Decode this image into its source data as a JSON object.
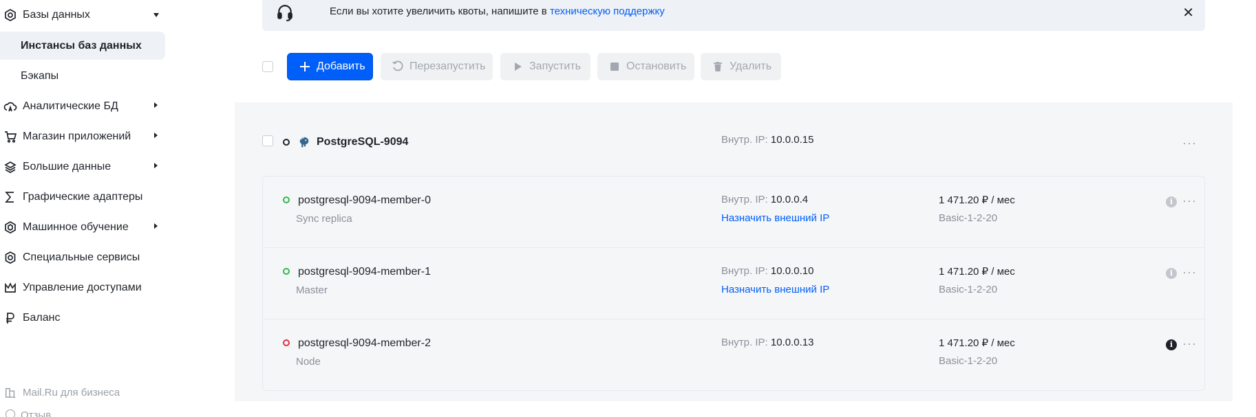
{
  "sidebar": {
    "databases": "Базы данных",
    "db_instances": "Инстансы баз данных",
    "backups": "Бэкапы",
    "analytic_db": "Аналитические БД",
    "app_store": "Магазин приложений",
    "big_data": "Большие данные",
    "gpu": "Графические адаптеры",
    "ml": "Машинное обучение",
    "special": "Специальные сервисы",
    "access": "Управление доступами",
    "balance": "Баланс",
    "mailru_business": "Mail.Ru для бизнеса",
    "feedback_partial": "Отзыв"
  },
  "banner": {
    "text": "Если вы хотите увеличить квоты, напишите в ",
    "link": "техническую поддержку",
    "close": "✕"
  },
  "toolbar": {
    "add": "Добавить",
    "restart": "Перезапустить",
    "start": "Запустить",
    "stop": "Остановить",
    "delete": "Удалить"
  },
  "group": {
    "name": "PostgreSQL-9094",
    "ip_label": "Внутр. IP:",
    "ip": "10.0.0.15",
    "menu": "···"
  },
  "members": [
    {
      "name": "postgresql-9094-member-0",
      "role": "Sync replica",
      "ip_label": "Внутр. IP:",
      "ip": "10.0.0.4",
      "ext_ip": "Назначить внешний IP",
      "price": "1 471.20 ₽ / мес",
      "plan": "Basic-1-2-20",
      "status": "green",
      "info": "i",
      "menu": "···"
    },
    {
      "name": "postgresql-9094-member-1",
      "role": "Master",
      "ip_label": "Внутр. IP:",
      "ip": "10.0.0.10",
      "ext_ip": "Назначить внешний IP",
      "price": "1 471.20 ₽ / мес",
      "plan": "Basic-1-2-20",
      "status": "green",
      "info": "i",
      "menu": "···"
    },
    {
      "name": "postgresql-9094-member-2",
      "role": "Node",
      "ip_label": "Внутр. IP:",
      "ip": "10.0.0.13",
      "ext_ip": "",
      "price": "1 471.20 ₽ / мес",
      "plan": "Basic-1-2-20",
      "status": "red",
      "info": "i",
      "menu": "···"
    }
  ],
  "colors": {
    "accent": "#005ff9",
    "status_ok": "#2fb84e",
    "status_error": "#e0303a"
  }
}
